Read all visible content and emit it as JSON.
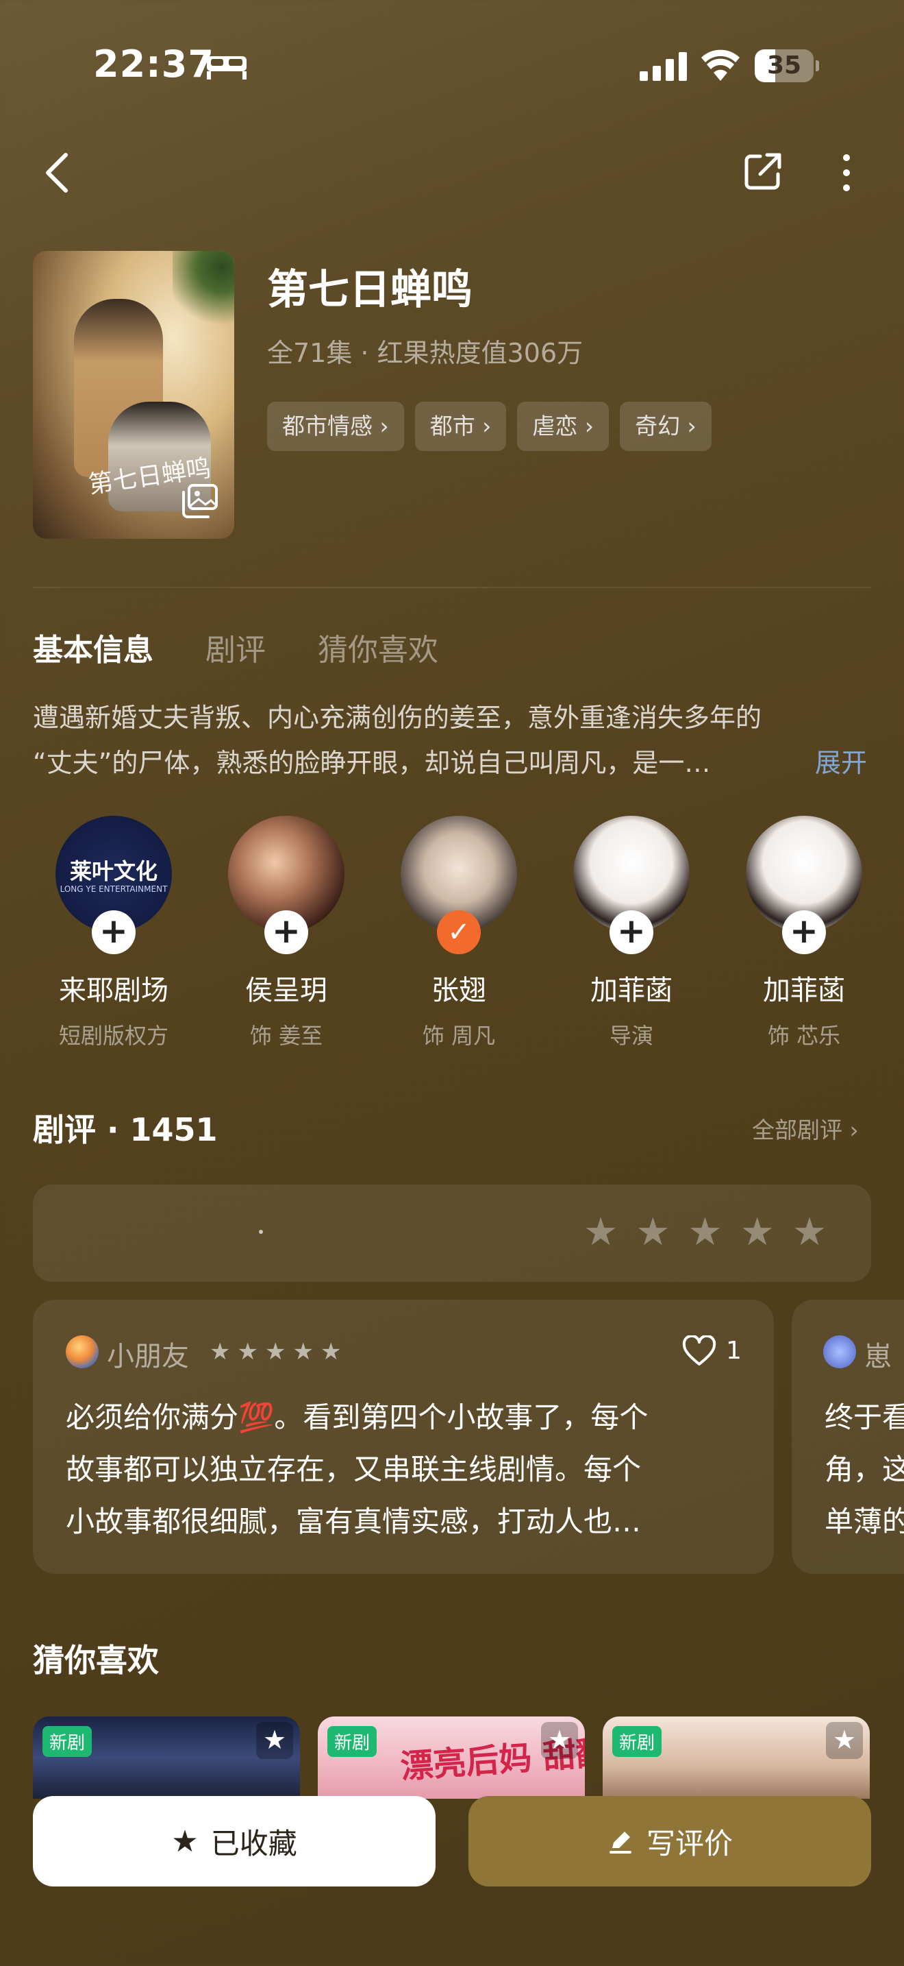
{
  "status_bar": {
    "time": "22:37",
    "battery": "35",
    "battery_level": 0.35
  },
  "header": {
    "title": "第七日蝉鸣",
    "meta": "全71集 · 红果热度值306万",
    "tags": [
      "都市情感",
      "都市",
      "虐恋",
      "奇幻"
    ],
    "poster_art_text": "第七日蝉鸣"
  },
  "tabs": [
    {
      "label": "基本信息",
      "active": true
    },
    {
      "label": "剧评",
      "active": false
    },
    {
      "label": "猜你喜欢",
      "active": false
    }
  ],
  "synopsis": {
    "line1": "遭遇新婚丈夫背叛、内心充满创伤的姜至，意外重逢消失多年的",
    "line2": "“丈夫”的尸体，熟悉的脸睁开眼，却说自己叫周凡，是一…",
    "expand_label": "展开"
  },
  "cast": [
    {
      "name": "来耶剧场",
      "role": "短剧版权方",
      "followed": false,
      "logo_text": "莱叶文化",
      "logo_sub": "LONG YE ENTERTAINMENT"
    },
    {
      "name": "侯呈玥",
      "role": "饰 姜至",
      "followed": false
    },
    {
      "name": "张翅",
      "role": "饰 周凡",
      "followed": true
    },
    {
      "name": "加菲菡",
      "role": "导演",
      "followed": false
    },
    {
      "name": "加菲菡",
      "role": "饰 芯乐",
      "followed": false
    }
  ],
  "reviews": {
    "title": "剧评 · 1451",
    "all_label": "全部剧评",
    "items": [
      {
        "user": "小朋友",
        "stars": 5,
        "likes": "1",
        "line1_a": "必须给你满分",
        "line1_emoji": "💯",
        "line1_b": "。看到第四个小故事了，每个",
        "line2": "故事都可以独立存在，又串联主线剧情。每个",
        "line3": "小故事都很细腻，富有真情实感，打动人也…"
      },
      {
        "user": "崽",
        "line1": "终于看",
        "line2": "角，这",
        "line3": "单薄的"
      }
    ]
  },
  "recommend": {
    "title": "猜你喜欢",
    "items": [
      {
        "badge": "新剧",
        "title": ""
      },
      {
        "badge": "新剧",
        "title": "漂亮后妈 甜翻全家"
      },
      {
        "badge": "新剧",
        "title": ""
      }
    ]
  },
  "bottom": {
    "fav_label": "已收藏",
    "write_label": "写评价"
  },
  "colors": {
    "accent_orange": "#f26b2c",
    "write_button": "#8f7638",
    "new_badge": "#1fb870",
    "expand_link": "#7fa8d8"
  }
}
